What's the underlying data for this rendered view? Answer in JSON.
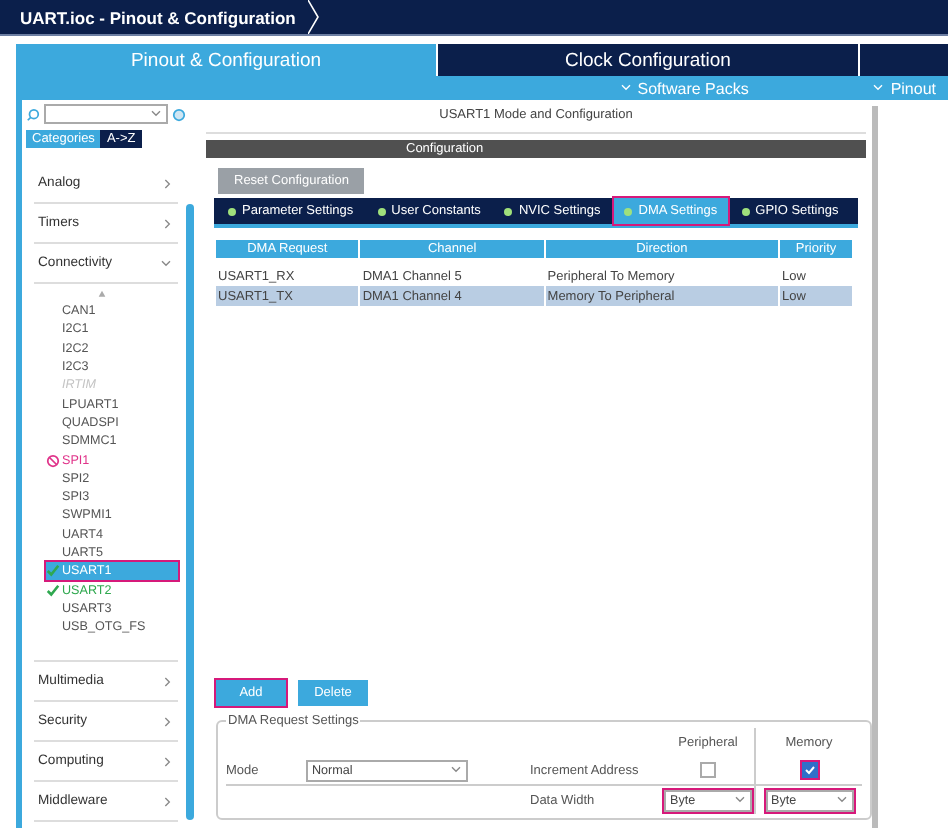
{
  "title_bar": {
    "breadcrumb": "UART.ioc - Pinout & Configuration"
  },
  "main_tabs": [
    {
      "label": "Pinout & Configuration",
      "selected": true
    },
    {
      "label": "Clock Configuration",
      "selected": false
    }
  ],
  "menus": [
    {
      "label": "Software Packs"
    },
    {
      "label": "Pinout"
    }
  ],
  "sidebar": {
    "view_tabs": [
      {
        "label": "Categories",
        "selected": true
      },
      {
        "label": "A->Z",
        "selected": false
      }
    ],
    "categories": [
      {
        "label": "Analog",
        "expanded": false
      },
      {
        "label": "Timers",
        "expanded": false
      },
      {
        "label": "Connectivity",
        "expanded": true,
        "children": [
          {
            "label": "CAN1",
            "kind": "plain",
            "selected": false,
            "highlighted": false
          },
          {
            "label": "I2C1",
            "kind": "plain",
            "selected": false,
            "highlighted": false
          },
          {
            "label": "I2C2",
            "kind": "plain",
            "selected": false,
            "highlighted": false
          },
          {
            "label": "I2C3",
            "kind": "plain",
            "selected": false,
            "highlighted": false
          },
          {
            "label": "IRTIM",
            "kind": "disabled",
            "selected": false,
            "highlighted": false
          },
          {
            "label": "LPUART1",
            "kind": "plain",
            "selected": false,
            "highlighted": false
          },
          {
            "label": "QUADSPI",
            "kind": "plain",
            "selected": false,
            "highlighted": false
          },
          {
            "label": "SDMMC1",
            "kind": "plain",
            "selected": false,
            "highlighted": false
          },
          {
            "label": "SPI1",
            "kind": "conflict",
            "selected": false,
            "highlighted": false
          },
          {
            "label": "SPI2",
            "kind": "plain",
            "selected": false,
            "highlighted": false
          },
          {
            "label": "SPI3",
            "kind": "plain",
            "selected": false,
            "highlighted": false
          },
          {
            "label": "SWPMI1",
            "kind": "plain",
            "selected": false,
            "highlighted": false
          },
          {
            "label": "UART4",
            "kind": "plain",
            "selected": false,
            "highlighted": false
          },
          {
            "label": "UART5",
            "kind": "plain",
            "selected": false,
            "highlighted": false
          },
          {
            "label": "USART1",
            "kind": "configured",
            "selected": true,
            "highlighted": true
          },
          {
            "label": "USART2",
            "kind": "configured",
            "selected": false,
            "highlighted": false
          },
          {
            "label": "USART3",
            "kind": "plain",
            "selected": false,
            "highlighted": false
          },
          {
            "label": "USB_OTG_FS",
            "kind": "plain",
            "selected": false,
            "highlighted": false
          }
        ]
      },
      {
        "label": "Multimedia",
        "expanded": false
      },
      {
        "label": "Security",
        "expanded": false
      },
      {
        "label": "Computing",
        "expanded": false
      },
      {
        "label": "Middleware",
        "expanded": false
      }
    ]
  },
  "panel": {
    "title": "USART1 Mode and Configuration",
    "section": "Configuration",
    "reset_button": "Reset Configuration",
    "tabs": [
      {
        "label": "Parameter Settings",
        "selected": false,
        "highlighted": false
      },
      {
        "label": "User Constants",
        "selected": false,
        "highlighted": false
      },
      {
        "label": "NVIC Settings",
        "selected": false,
        "highlighted": false
      },
      {
        "label": "DMA Settings",
        "selected": true,
        "highlighted": true
      },
      {
        "label": "GPIO Settings",
        "selected": false,
        "highlighted": false
      }
    ],
    "dma_table": {
      "columns": [
        "DMA Request",
        "Channel",
        "Direction",
        "Priority"
      ],
      "rows": [
        {
          "cells": [
            "USART1_RX",
            "DMA1 Channel 5",
            "Peripheral To Memory",
            "Low"
          ],
          "selected": false
        },
        {
          "cells": [
            "USART1_TX",
            "DMA1 Channel 4",
            "Memory To Peripheral",
            "Low"
          ],
          "selected": true
        }
      ]
    },
    "buttons": [
      {
        "label": "Add",
        "highlighted": true
      },
      {
        "label": "Delete",
        "highlighted": false
      }
    ],
    "settings": {
      "legend": "DMA Request Settings",
      "column_headers": [
        "Peripheral",
        "Memory"
      ],
      "mode": {
        "label": "Mode",
        "value": "Normal"
      },
      "increment": {
        "label": "Increment Address",
        "peripheral": {
          "checked": false,
          "highlighted": false
        },
        "memory": {
          "checked": true,
          "highlighted": true
        }
      },
      "data_width": {
        "label": "Data Width",
        "peripheral": {
          "value": "Byte",
          "highlighted": true
        },
        "memory": {
          "value": "Byte",
          "highlighted": true
        }
      }
    }
  }
}
